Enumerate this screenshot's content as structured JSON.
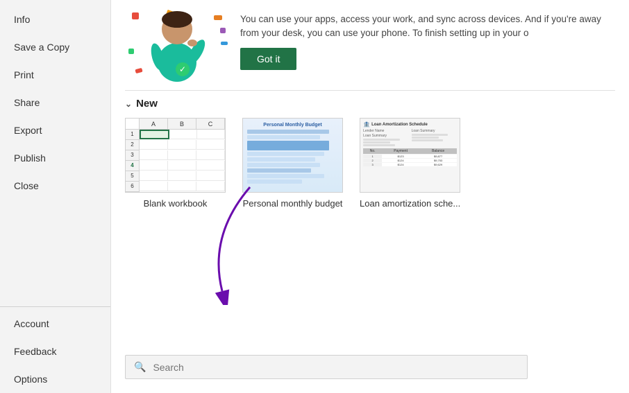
{
  "sidebar": {
    "top_items": [
      {
        "id": "info",
        "label": "Info"
      },
      {
        "id": "save-a-copy",
        "label": "Save a Copy"
      },
      {
        "id": "print",
        "label": "Print"
      },
      {
        "id": "share",
        "label": "Share"
      },
      {
        "id": "export",
        "label": "Export"
      },
      {
        "id": "publish",
        "label": "Publish"
      },
      {
        "id": "close",
        "label": "Close"
      }
    ],
    "bottom_items": [
      {
        "id": "account",
        "label": "Account"
      },
      {
        "id": "feedback",
        "label": "Feedback"
      },
      {
        "id": "options",
        "label": "Options"
      }
    ]
  },
  "banner": {
    "text": "You can use your apps, access your work, and sync across devices. And if you're away from your desk, you can use your phone. To finish setting up in your o",
    "got_it_label": "Got it"
  },
  "new_section": {
    "header": "New",
    "templates": [
      {
        "id": "blank-workbook",
        "label": "Blank workbook"
      },
      {
        "id": "personal-monthly-budget",
        "label": "Personal monthly budget"
      },
      {
        "id": "loan-amortization-schedule",
        "label": "Loan amortization sche..."
      }
    ]
  },
  "search": {
    "placeholder": "Search",
    "icon": "🔍"
  },
  "colors": {
    "got_it_bg": "#217346",
    "sidebar_bg": "#f3f3f3",
    "selected_cell": "#217346"
  }
}
